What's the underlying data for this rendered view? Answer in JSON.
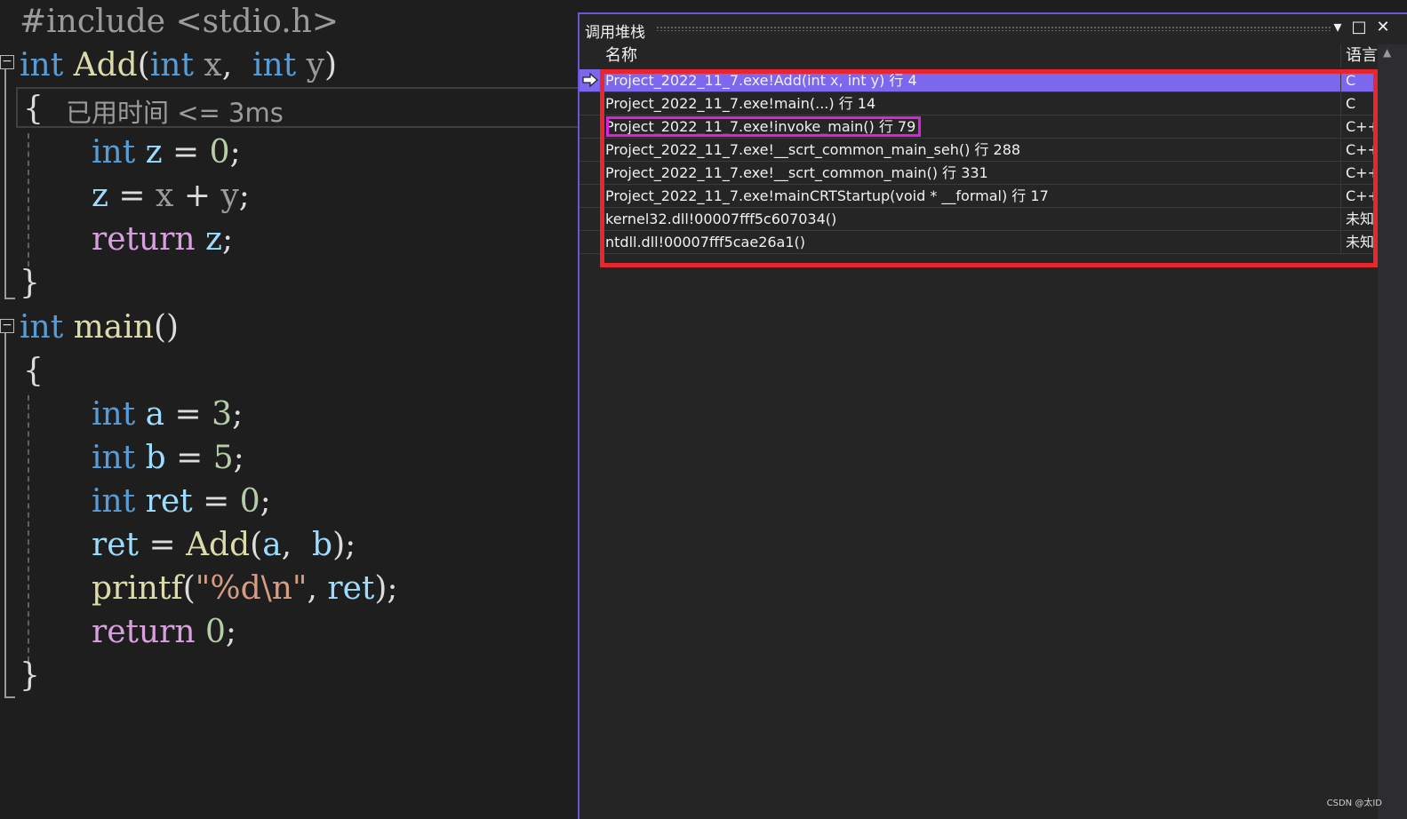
{
  "editor": {
    "lines": {
      "l1": {
        "pre": "#include <stdio.h>"
      },
      "l2": {
        "kw": "int",
        "fn": "Add",
        "open": "(",
        "kw2": "int",
        "p1": "x",
        "comma": ",",
        "kw3": "int",
        "p2": "y",
        "close": ")"
      },
      "l3": {
        "brace": "{"
      },
      "l4": {
        "kw": "int",
        "v": "z",
        "op": "=",
        "num": "0",
        "semi": ";"
      },
      "l5": {
        "v": "z",
        "op": "=",
        "x": "x",
        "plus": "+",
        "y": "y",
        "semi": ";"
      },
      "l6": {
        "ret": "return",
        "v": "z",
        "semi": ";"
      },
      "l7": {
        "brace": "}"
      },
      "l8": {
        "kw": "int",
        "fn": "main",
        "paren": "()"
      },
      "l9": {
        "brace": "{"
      },
      "l10": {
        "kw": "int",
        "v": "a",
        "op": "=",
        "num": "3",
        "semi": ";"
      },
      "l11": {
        "kw": "int",
        "v": "b",
        "op": "=",
        "num": "5",
        "semi": ";"
      },
      "l12": {
        "kw": "int",
        "v": "ret",
        "op": "=",
        "num": "0",
        "semi": ";"
      },
      "l13": {
        "v": "ret",
        "op": "=",
        "fn": "Add",
        "open": "(",
        "a": "a",
        "comma": ",",
        "b": "b",
        "close": ")",
        "semi": ";"
      },
      "l14": {
        "fn": "printf",
        "open": "(",
        "str": "\"%d\\n\"",
        "comma": ",",
        "v": "ret",
        "close": ")",
        "semi": ";"
      },
      "l15": {
        "ret": "return",
        "num": "0",
        "semi": ";"
      },
      "l16": {
        "brace": "}"
      }
    },
    "perf_hint": "已用时间 <= 3ms"
  },
  "call_stack": {
    "title": "调用堆栈",
    "col_name": "名称",
    "col_lang": "语言",
    "rows": [
      {
        "name": "Project_2022_11_7.exe!Add(int x, int y) 行 4",
        "lang": "C"
      },
      {
        "name": "Project_2022_11_7.exe!main(...) 行 14",
        "lang": "C"
      },
      {
        "name": "Project_2022_11_7.exe!invoke_main() 行 79",
        "lang": "C++"
      },
      {
        "name": "Project_2022_11_7.exe!__scrt_common_main_seh() 行 288",
        "lang": "C++"
      },
      {
        "name": "Project_2022_11_7.exe!__scrt_common_main() 行 331",
        "lang": "C++"
      },
      {
        "name": "Project_2022_11_7.exe!mainCRTStartup(void * __formal) 行 17",
        "lang": "C++"
      },
      {
        "name": "kernel32.dll!00007fff5c607034()",
        "lang": "未知"
      },
      {
        "name": "ntdll.dll!00007fff5cae26a1()",
        "lang": "未知"
      }
    ],
    "buttons": {
      "dropdown": "▾",
      "maximize": "□",
      "close": "✕"
    }
  },
  "watermark": "CSDN @太ID",
  "colors": {
    "accent": "#7b68ee",
    "highlight_red": "#e8262d",
    "highlight_magenta": "#e020e0"
  },
  "icons": {
    "current_frame": "current-frame-arrow-icon",
    "collapse": "collapse-minus-icon"
  }
}
